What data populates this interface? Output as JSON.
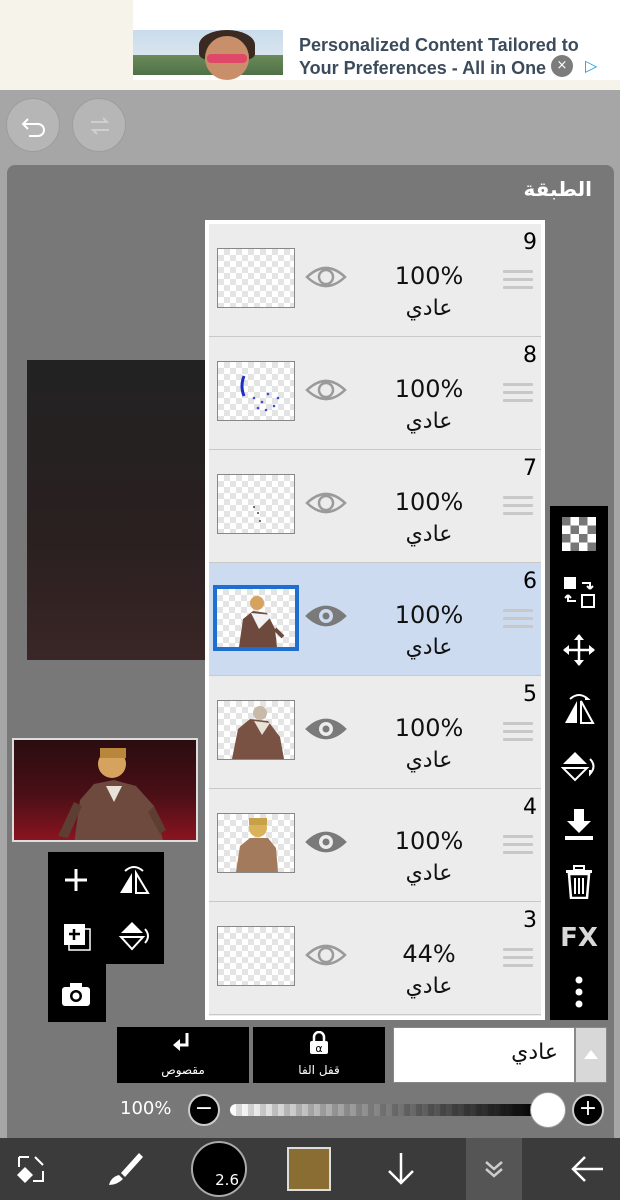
{
  "ad": {
    "headline": "Personalized Content Tailored to Your Preferences - All in One",
    "close_glyph": "×",
    "choices_glyph": "▷"
  },
  "panel": {
    "title": "الطبقة"
  },
  "layers": [
    {
      "number": "9",
      "opacity": "100%",
      "blend": "عادي",
      "visible": true,
      "selected": false
    },
    {
      "number": "8",
      "opacity": "100%",
      "blend": "عادي",
      "visible": true,
      "selected": false
    },
    {
      "number": "7",
      "opacity": "100%",
      "blend": "عادي",
      "visible": true,
      "selected": false
    },
    {
      "number": "6",
      "opacity": "100%",
      "blend": "عادي",
      "visible": true,
      "selected": true
    },
    {
      "number": "5",
      "opacity": "100%",
      "blend": "عادي",
      "visible": true,
      "selected": false
    },
    {
      "number": "4",
      "opacity": "100%",
      "blend": "عادي",
      "visible": true,
      "selected": false
    },
    {
      "number": "3",
      "opacity": "44%",
      "blend": "عادي",
      "visible": true,
      "selected": false
    }
  ],
  "bottom_controls": {
    "clipping_label": "مقصوص",
    "alpha_lock_label": "قفل الفا",
    "alpha_glyph": "α",
    "blend_mode_value": "عادي"
  },
  "opacity_control": {
    "value_label": "100%",
    "value": 1.0,
    "minus": "−",
    "plus": "+"
  },
  "toolbar": {
    "brush_size": "2.6",
    "color_swatch": "#8a6d33",
    "right_fx_label": "FX"
  },
  "colors": {
    "panel_bg": "#787878",
    "selected_layer": "#ccdbef",
    "selection_border": "#1e6fd0",
    "bottom_bar": "#3b3b3b"
  }
}
